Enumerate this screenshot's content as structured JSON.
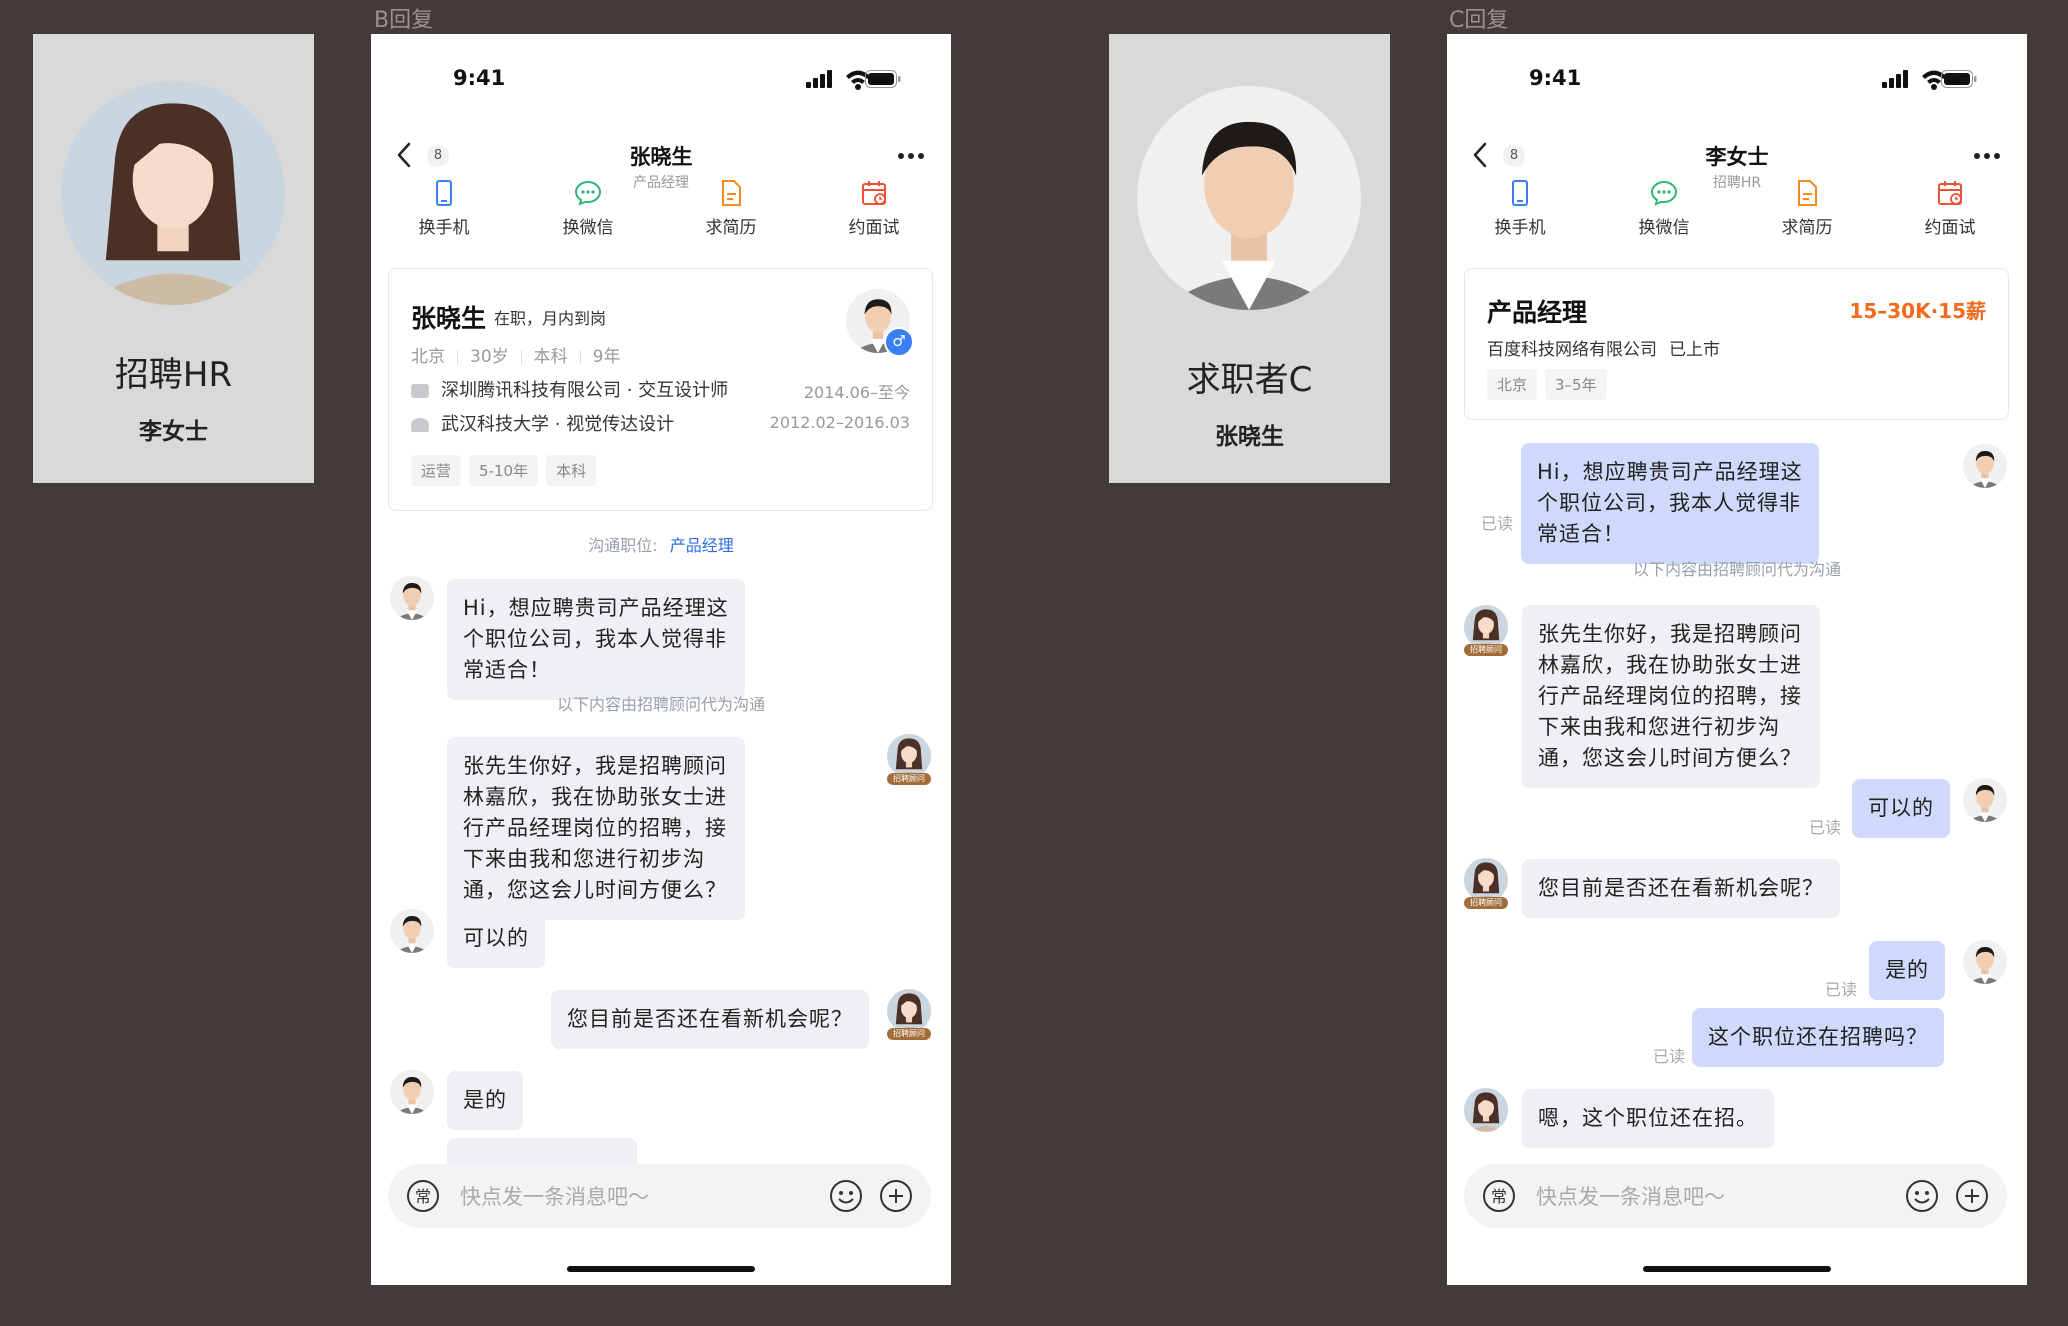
{
  "frames": {
    "b_label": "B回复",
    "c_label": "C回复"
  },
  "card_hr": {
    "role": "招聘HR",
    "name": "李女士"
  },
  "card_seeker": {
    "role": "求职者C",
    "name": "张晓生"
  },
  "status": {
    "time": "9:41"
  },
  "quick_actions": {
    "phone": "换手机",
    "wechat": "换微信",
    "resume": "求简历",
    "interview": "约面试"
  },
  "input": {
    "placeholder": "快点发一条消息吧～",
    "common": "常"
  },
  "phone_b": {
    "unread": "8",
    "title": "张晓生",
    "subtitle": "产品经理",
    "profile": {
      "name": "张晓生",
      "status": "在职，月内到岗",
      "city": "北京",
      "age": "30岁",
      "edu": "本科",
      "years": "9年",
      "work": "深圳腾讯科技有限公司 · 交互设计师",
      "work_date": "2014.06–至今",
      "school": "武汉科技大学 · 视觉传达设计",
      "school_date": "2012.02–2016.03",
      "tags": [
        "运营",
        "5-10年",
        "本科"
      ],
      "gender": "♂"
    },
    "position_label": "沟通职位:",
    "position_value": "产品经理",
    "advisor_note": "以下内容由招聘顾问代为沟通",
    "advisor_badge": "招聘顾问",
    "messages": [
      "Hi，想应聘贵司产品经理这个职位公司，我本人觉得非常适合！",
      "张先生你好，我是招聘顾问林嘉欣，我在协助张女士进行产品经理岗位的招聘，接下来由我和您进行初步沟通，您这会儿时间方便么？",
      "可以的",
      "您目前是否还在看新机会呢？",
      "是的"
    ]
  },
  "phone_c": {
    "unread": "8",
    "title": "李女士",
    "subtitle": "招聘HR",
    "job": {
      "title": "产品经理",
      "salary": "15–30K·15薪",
      "company": "百度科技网络有限公司",
      "stage": "已上市",
      "tags": [
        "北京",
        "3–5年"
      ]
    },
    "read_label": "已读",
    "advisor_note": "以下内容由招聘顾问代为沟通",
    "advisor_badge": "招聘顾问",
    "messages": [
      "Hi，想应聘贵司产品经理这个职位公司，我本人觉得非常适合！",
      "张先生你好，我是招聘顾问林嘉欣，我在协助张女士进行产品经理岗位的招聘，接下来由我和您进行初步沟通，您这会儿时间方便么？",
      "可以的",
      "您目前是否还在看新机会呢？",
      "是的",
      "这个职位还在招聘吗？",
      "嗯，这个职位还在招。"
    ]
  },
  "colors": {
    "accent_blue": "#2e6be6",
    "salary_orange": "#f26b1d",
    "bubble_blue": "#cfd9fb",
    "bubble_grey": "#eef0f3"
  }
}
